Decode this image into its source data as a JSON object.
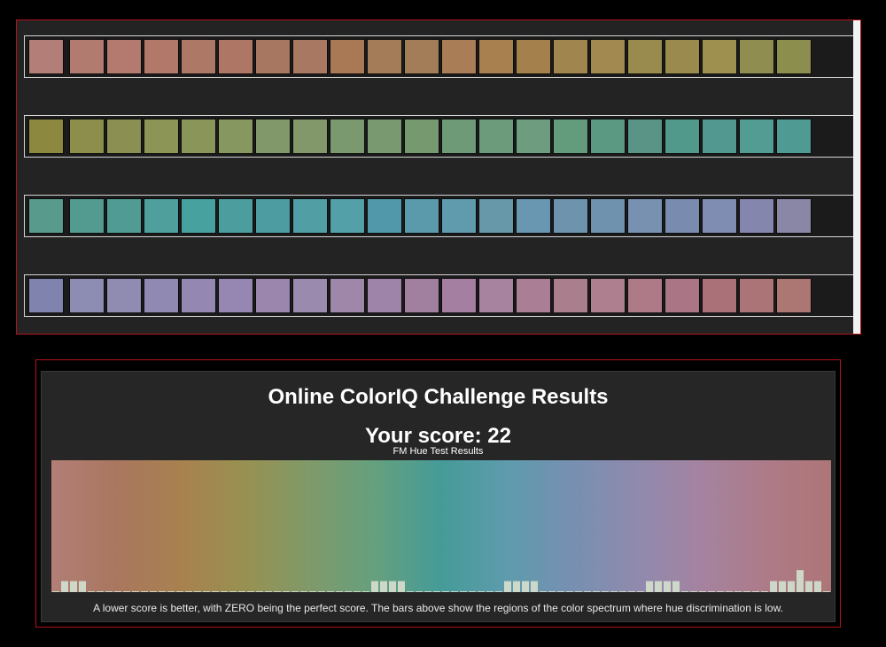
{
  "rows": [
    [
      "#b27e77",
      "#b17b70",
      "#b47a70",
      "#b2796b",
      "#ae7866",
      "#ad7665",
      "#a87761",
      "#a97863",
      "#a97855",
      "#a47c58",
      "#a37d58",
      "#a97e57",
      "#a8804f",
      "#a3804c",
      "#a0854f",
      "#a28950",
      "#988b4d",
      "#9a8a4e",
      "#9e9150",
      "#8f8d4f",
      "#8b8e4d"
    ],
    [
      "#8d8840",
      "#8d8e4c",
      "#8b9052",
      "#8c9456",
      "#8a9559",
      "#86975f",
      "#81986a",
      "#83986a",
      "#7b996e",
      "#799a71",
      "#76996f",
      "#6f9a78",
      "#6b9b7b",
      "#6d9d7e",
      "#629c7c",
      "#5c9982",
      "#5a9487",
      "#519a8b",
      "#529890",
      "#539c93",
      "#4f9a92"
    ],
    [
      "#589b8c",
      "#539a91",
      "#519b95",
      "#4f9f9d",
      "#46a19f",
      "#4b9d9e",
      "#4c9ca1",
      "#519ea5",
      "#53a0a9",
      "#5198ab",
      "#5a9aab",
      "#5f9bad",
      "#6698aa",
      "#6996b0",
      "#6e93ac",
      "#6f92ae",
      "#7891b1",
      "#798cb0",
      "#7f8db3",
      "#8586ad",
      "#8a86a6"
    ],
    [
      "#8083ad",
      "#8d8db4",
      "#908bb0",
      "#9089b1",
      "#9488b3",
      "#9587b1",
      "#9b87ad",
      "#9a8aae",
      "#9e87a9",
      "#9f84a9",
      "#a1809f",
      "#a57fa2",
      "#a8839f",
      "#aa7f95",
      "#aa7e8d",
      "#ae7f8f",
      "#ae7a87",
      "#aa7685",
      "#ab7179",
      "#ab7578",
      "#ac7672"
    ]
  ],
  "results": {
    "title": "Online ColorIQ Challenge Results",
    "score": "Your score: 22",
    "footnote": "A lower score is better, with ZERO being the perfect score. The bars above show the regions of the color spectrum where hue discrimination is low."
  },
  "chart_data": {
    "type": "bar",
    "title": "FM Hue Test Results",
    "xlabel": "",
    "ylabel": "",
    "grid": false,
    "bar_color": "#cdd8c8",
    "spectrum": [
      "#b27e77",
      "#a9775f",
      "#a8814f",
      "#979151",
      "#7f9a6a",
      "#64a07e",
      "#459b98",
      "#5e9bad",
      "#7690b1",
      "#8f8aae",
      "#a583a0",
      "#ad7b88",
      "#ad7576"
    ],
    "values": [
      0,
      1,
      1,
      1,
      0,
      0,
      0,
      0,
      0,
      0,
      0,
      0,
      0,
      0,
      0,
      0,
      0,
      0,
      0,
      0,
      0,
      0,
      0,
      0,
      0,
      0,
      0,
      0,
      0,
      0,
      0,
      0,
      0,
      0,
      0,
      0,
      1,
      1,
      1,
      1,
      0,
      0,
      0,
      0,
      0,
      0,
      0,
      0,
      0,
      0,
      0,
      1,
      1,
      1,
      1,
      0,
      0,
      0,
      0,
      0,
      0,
      0,
      0,
      0,
      0,
      0,
      0,
      1,
      1,
      1,
      1,
      0,
      0,
      0,
      0,
      0,
      0,
      0,
      0,
      0,
      0,
      1,
      1,
      1,
      2,
      1,
      1,
      0
    ],
    "ylim": [
      0,
      12
    ]
  }
}
